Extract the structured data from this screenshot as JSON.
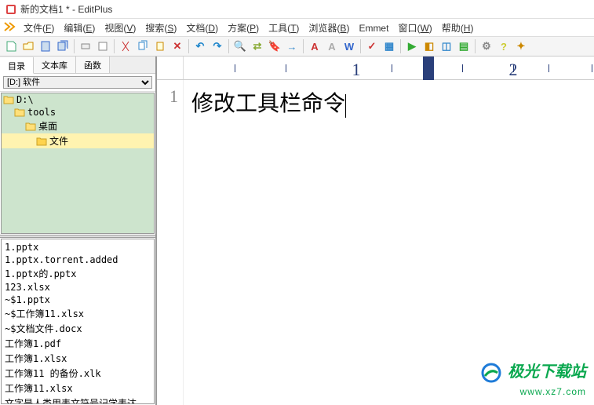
{
  "window": {
    "title": "新的文档1 * - EditPlus"
  },
  "menu": {
    "items": [
      {
        "label": "文件",
        "key": "F"
      },
      {
        "label": "编辑",
        "key": "E"
      },
      {
        "label": "视图",
        "key": "V"
      },
      {
        "label": "搜索",
        "key": "S"
      },
      {
        "label": "文档",
        "key": "D"
      },
      {
        "label": "方案",
        "key": "P"
      },
      {
        "label": "工具",
        "key": "T"
      },
      {
        "label": "浏览器",
        "key": "B"
      },
      {
        "label": "Emmet",
        "key": ""
      },
      {
        "label": "窗口",
        "key": "W"
      },
      {
        "label": "帮助",
        "key": "H"
      }
    ]
  },
  "toolbar": {
    "groups": [
      [
        "new-file",
        "open-file",
        "save",
        "save-all"
      ],
      [
        "print",
        "print-preview"
      ],
      [
        "cut",
        "copy",
        "paste",
        "delete"
      ],
      [
        "undo",
        "redo"
      ],
      [
        "find",
        "find-replace",
        "bookmark",
        "goto"
      ],
      [
        "font-increase",
        "font-decrease",
        "word-wrap"
      ],
      [
        "spell-check",
        "column-select"
      ],
      [
        "browser-preview",
        "browser-toggle",
        "side-panel",
        "output-panel"
      ],
      [
        "settings",
        "help",
        "plugin"
      ]
    ]
  },
  "sidebar": {
    "tabs": [
      {
        "label": "目录",
        "active": true
      },
      {
        "label": "文本库",
        "active": false
      },
      {
        "label": "函数",
        "active": false
      }
    ],
    "drive": {
      "selected": "[D:]  软件"
    },
    "tree": [
      {
        "indent": 0,
        "label": "D:\\",
        "open": true
      },
      {
        "indent": 1,
        "label": "tools",
        "open": true
      },
      {
        "indent": 2,
        "label": "桌面",
        "open": true
      },
      {
        "indent": 3,
        "label": "文件",
        "open": false,
        "selected": true
      }
    ],
    "files": [
      "1.pptx",
      "1.pptx.torrent.added",
      "1.pptx的.pptx",
      "123.xlsx",
      "~$1.pptx",
      "~$工作簿11.xlsx",
      "~$文档文件.docx",
      "工作簿1.pdf",
      "工作簿1.xlsx",
      "工作簿11 的备份.xlk",
      "工作簿11.xlsx",
      "文字是人类用表文符号记学表达"
    ]
  },
  "ruler": {
    "marks": [
      {
        "type": "minor",
        "pos": 65
      },
      {
        "type": "minor",
        "pos": 130
      },
      {
        "type": "num",
        "pos": 220,
        "label": "1"
      },
      {
        "type": "minor",
        "pos": 265
      },
      {
        "type": "marker",
        "pos": 305
      },
      {
        "type": "minor",
        "pos": 355
      },
      {
        "type": "num",
        "pos": 420,
        "label": "2"
      },
      {
        "type": "minor",
        "pos": 465
      },
      {
        "type": "minor",
        "pos": 520
      }
    ]
  },
  "editor": {
    "line_number": "1",
    "text": "修改工具栏命令"
  },
  "watermark": {
    "name": "极光下载站",
    "url": "www.xz7.com"
  }
}
